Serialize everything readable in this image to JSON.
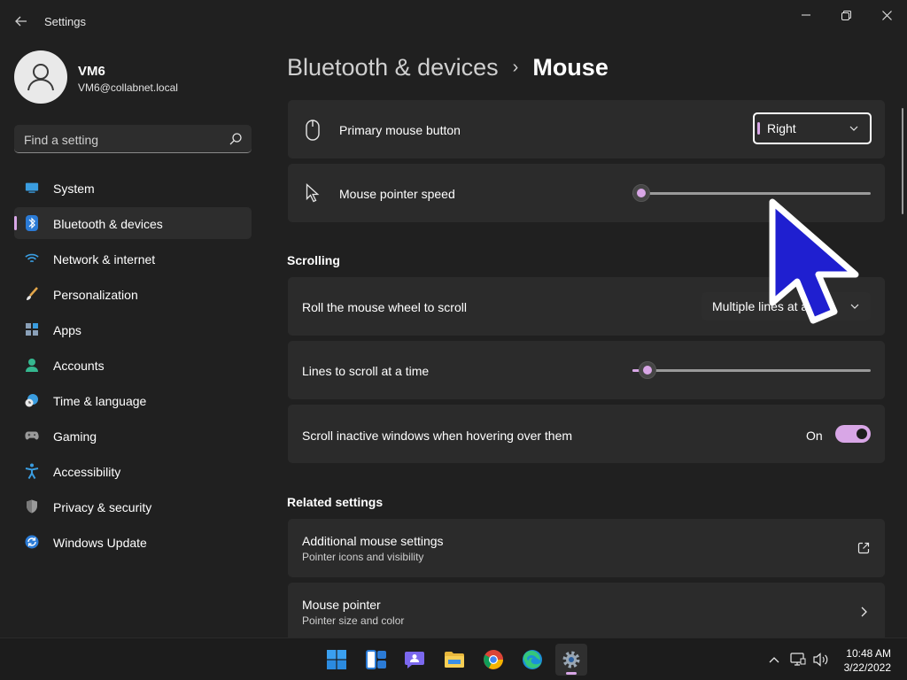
{
  "window": {
    "title": "Settings"
  },
  "user": {
    "name": "VM6",
    "email": "VM6@collabnet.local"
  },
  "search": {
    "placeholder": "Find a setting"
  },
  "sidebar": {
    "items": [
      {
        "label": "System",
        "icon": "system-icon"
      },
      {
        "label": "Bluetooth & devices",
        "icon": "bluetooth-icon",
        "active": true
      },
      {
        "label": "Network & internet",
        "icon": "wifi-icon"
      },
      {
        "label": "Personalization",
        "icon": "brush-icon"
      },
      {
        "label": "Apps",
        "icon": "apps-icon"
      },
      {
        "label": "Accounts",
        "icon": "accounts-icon"
      },
      {
        "label": "Time & language",
        "icon": "clock-globe-icon"
      },
      {
        "label": "Gaming",
        "icon": "gamepad-icon"
      },
      {
        "label": "Accessibility",
        "icon": "accessibility-icon"
      },
      {
        "label": "Privacy & security",
        "icon": "shield-icon"
      },
      {
        "label": "Windows Update",
        "icon": "update-icon"
      }
    ]
  },
  "breadcrumb": {
    "parent": "Bluetooth & devices",
    "separator": "›",
    "current": "Mouse"
  },
  "settings": {
    "primary_button": {
      "label": "Primary mouse button",
      "value": "Right",
      "icon": "mouse-icon"
    },
    "pointer_speed": {
      "label": "Mouse pointer speed",
      "value_fraction": 0.0,
      "icon": "pointer-icon"
    },
    "scrolling_title": "Scrolling",
    "roll_wheel": {
      "label": "Roll the mouse wheel to scroll",
      "value": "Multiple lines at a time"
    },
    "lines_to_scroll": {
      "label": "Lines to scroll at a time",
      "value_fraction": 0.03
    },
    "scroll_inactive": {
      "label": "Scroll inactive windows when hovering over them",
      "state": "On",
      "on": true
    },
    "related_title": "Related settings",
    "additional_mouse": {
      "label": "Additional mouse settings",
      "sublabel": "Pointer icons and visibility",
      "icon": "external-link-icon"
    },
    "mouse_pointer": {
      "label": "Mouse pointer",
      "sublabel": "Pointer size and color",
      "icon": "chevron-right-icon"
    }
  },
  "taskbar": {
    "apps": [
      "start-icon",
      "widgets-icon",
      "chat-icon",
      "file-explorer-icon",
      "chrome-icon",
      "edge-icon",
      "settings-icon"
    ],
    "active_app": "settings-icon"
  },
  "tray": {
    "time": "10:48 AM",
    "date": "3/22/2022"
  },
  "colors": {
    "accent": "#d8a6e6",
    "background": "#202020",
    "card": "#2b2b2b",
    "overlay_cursor": "#1f1fd0"
  }
}
